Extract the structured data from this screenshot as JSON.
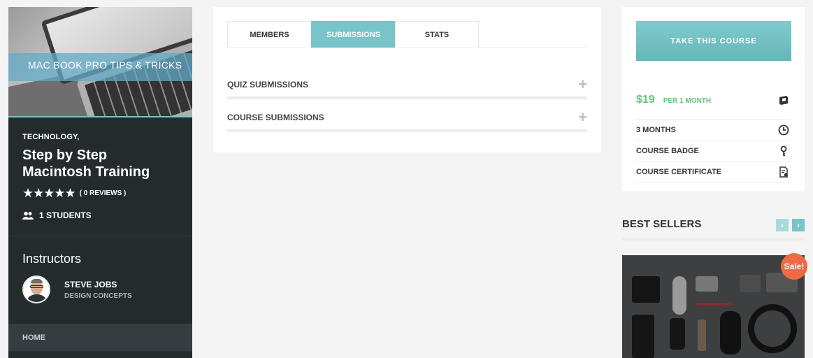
{
  "sidebar": {
    "hero_text": "MAC BOOK PRO TIPS & TRICKS",
    "category": "TECHNOLOGY,",
    "title": "Step by Step Macintosh Training",
    "stars": "★★★★★",
    "reviews": "( 0 REVIEWS )",
    "students": "1 STUDENTS",
    "instructors_heading": "Instructors",
    "instructor": {
      "name": "STEVE JOBS",
      "role": "DESIGN CONCEPTS"
    },
    "nav_home": "HOME"
  },
  "main": {
    "tabs": [
      {
        "label": "MEMBERS",
        "active": false
      },
      {
        "label": "SUBMISSIONS",
        "active": true
      },
      {
        "label": "STATS",
        "active": false
      }
    ],
    "accordion": [
      {
        "title": "QUIZ SUBMISSIONS",
        "toggle": "+"
      },
      {
        "title": "COURSE SUBMISSIONS",
        "toggle": "+"
      }
    ]
  },
  "buy_panel": {
    "button": "TAKE THIS COURSE",
    "price": "$19",
    "period": "PER 1 MONTH",
    "details": [
      {
        "label": "3 MONTHS",
        "icon": "clock-icon"
      },
      {
        "label": "COURSE BADGE",
        "icon": "badge-icon"
      },
      {
        "label": "COURSE CERTIFICATE",
        "icon": "certificate-icon"
      }
    ],
    "price_icon": "ticket-icon"
  },
  "best_sellers": {
    "title": "BEST SELLERS",
    "prev": "‹",
    "next": "›",
    "sale_badge": "Sale!"
  },
  "colors": {
    "accent": "#78c4c8",
    "price": "#6ac27b",
    "sale": "#ef6a42",
    "sidebar_bg": "#232b2d"
  }
}
